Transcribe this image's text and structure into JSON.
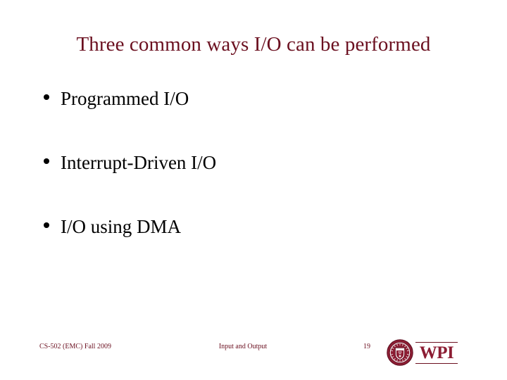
{
  "slide": {
    "title": "Three common ways I/O can be performed",
    "bullets": [
      {
        "text": "Programmed I/O"
      },
      {
        "text": "Interrupt-Driven I/O"
      },
      {
        "text": "I/O using DMA"
      }
    ],
    "footer": {
      "left": "CS-502 (EMC) Fall 2009",
      "center": "Input and Output",
      "page_number": "19"
    },
    "logo": {
      "wordmark": "WPI",
      "seal_icon": "wpi-seal-icon"
    },
    "colors": {
      "title": "#6b1020",
      "body": "#000000",
      "footer": "#6b1020",
      "logo": "#8c1d33",
      "background": "#ffffff"
    }
  }
}
